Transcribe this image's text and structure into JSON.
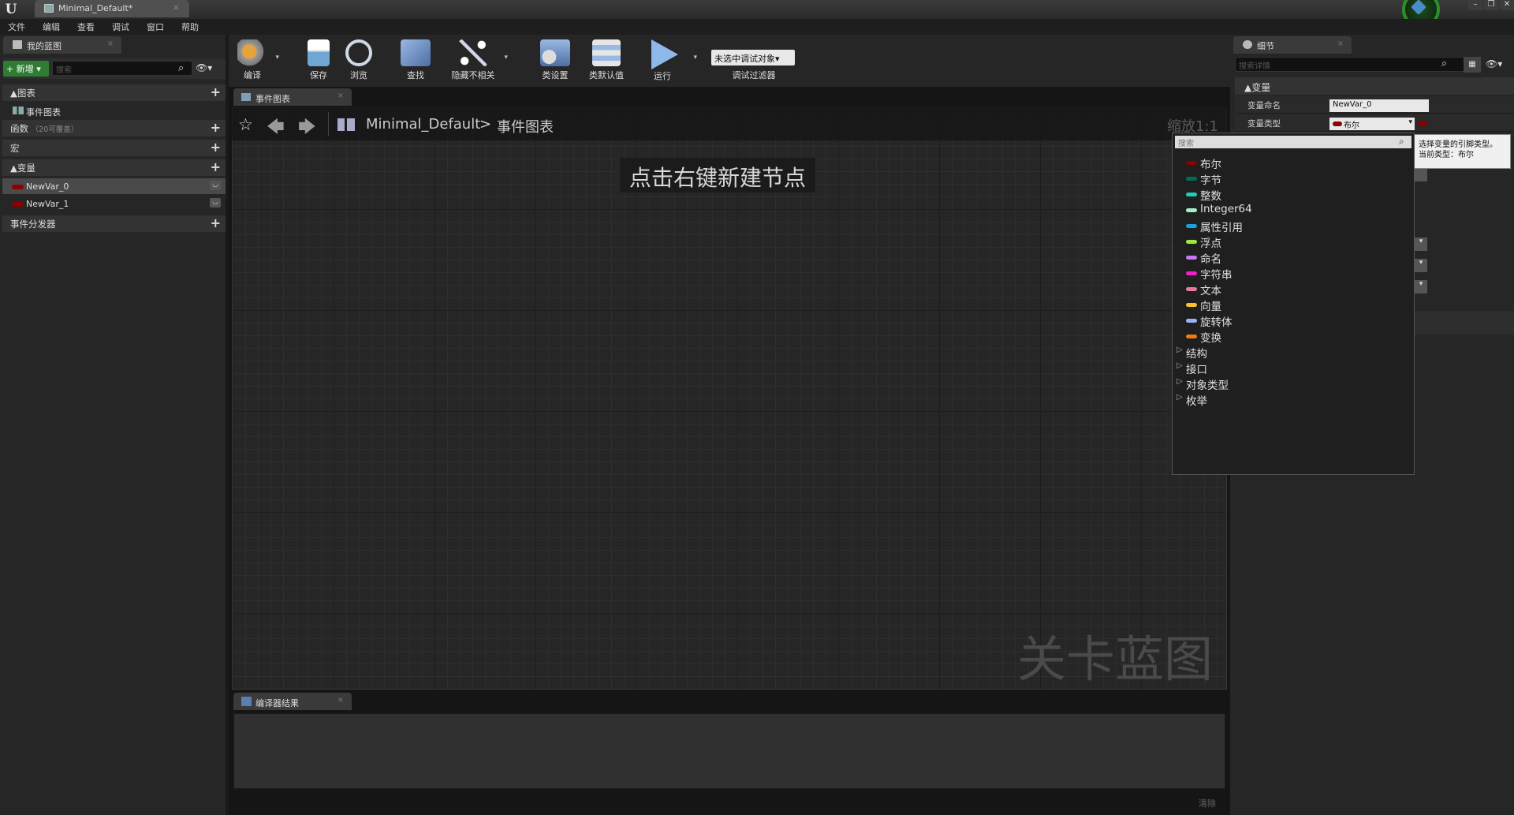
{
  "window": {
    "tab_title": "Minimal_Default*"
  },
  "menu": [
    "文件",
    "编辑",
    "查看",
    "调试",
    "窗口",
    "帮助"
  ],
  "left_panel": {
    "tab": "我的蓝图",
    "add_label": "+ 新增 ▾",
    "search_placeholder": "搜索",
    "sections": {
      "graphs": "▲图表",
      "event_graph": "事件图表",
      "functions": "函数",
      "functions_note": "（20可覆盖）",
      "macros": "宏",
      "variables": "▲变量",
      "dispatchers": "事件分发器"
    },
    "variables": [
      "NewVar_0",
      "NewVar_1"
    ]
  },
  "toolbar": {
    "compile": "编译",
    "save": "保存",
    "browse": "浏览",
    "find": "查找",
    "hide_unrelated": "隐藏不相关",
    "class_settings": "类设置",
    "class_defaults": "类默认值",
    "play": "运行",
    "debug_select": "未选中调试对象▾",
    "debug_filter": "调试过滤器"
  },
  "graph": {
    "tab": "事件图表",
    "breadcrumb_blueprint": "Minimal_Default",
    "breadcrumb_sep": ">",
    "breadcrumb_graph": "事件图表",
    "zoom": "缩放1:1",
    "hint": "点击右键新建节点",
    "watermark": "关卡蓝图"
  },
  "compiler": {
    "tab": "编译器结果",
    "clear": "清除"
  },
  "details": {
    "tab": "细节",
    "search_placeholder": "搜索详情",
    "section": "▲变量",
    "name_label": "变量命名",
    "name_value": "NewVar_0",
    "type_label": "变量类型",
    "type_value": "布尔"
  },
  "tooltip": {
    "line1": "选择变量的引脚类型。",
    "line2": "当前类型：布尔"
  },
  "type_dropdown": {
    "search_placeholder": "搜索",
    "types": [
      {
        "label": "布尔",
        "color": "#8b0000"
      },
      {
        "label": "字节",
        "color": "#006c5a"
      },
      {
        "label": "整数",
        "color": "#1ecfb0"
      },
      {
        "label": "Integer64",
        "color": "#a8ecc8"
      },
      {
        "label": "属性引用",
        "color": "#18a0e0"
      },
      {
        "label": "浮点",
        "color": "#9ae83c"
      },
      {
        "label": "命名",
        "color": "#c878f0"
      },
      {
        "label": "字符串",
        "color": "#f020c8"
      },
      {
        "label": "文本",
        "color": "#e87898"
      },
      {
        "label": "向量",
        "color": "#f8c030"
      },
      {
        "label": "旋转体",
        "color": "#a0b0f8"
      },
      {
        "label": "变换",
        "color": "#f07818"
      }
    ],
    "categories": [
      "结构",
      "接口",
      "对象类型",
      "枚举"
    ]
  }
}
